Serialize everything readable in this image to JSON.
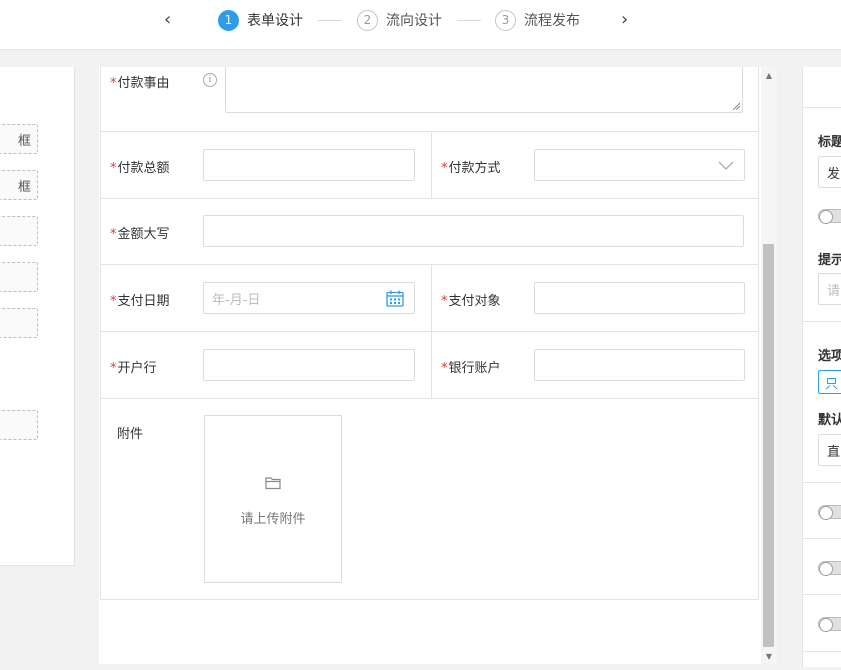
{
  "stepper": {
    "prev_icon": "chevron-left-icon",
    "next_icon": "chevron-right-icon",
    "steps": [
      {
        "number": "1",
        "label": "表单设计",
        "active": true
      },
      {
        "number": "2",
        "label": "流向设计",
        "active": false
      },
      {
        "number": "3",
        "label": "流程发布",
        "active": false
      }
    ]
  },
  "palette": {
    "items": [
      "框",
      "框",
      "",
      "",
      "",
      ""
    ]
  },
  "form": {
    "required_mark": "*",
    "reason_label": "付款事由",
    "total_label": "付款总额",
    "method_label": "付款方式",
    "uppercase_label": "金额大写",
    "date_label": "支付日期",
    "date_placeholder": "年-月-日",
    "payee_label": "支付对象",
    "bank_label": "开户行",
    "account_label": "银行账户",
    "attachment_label": "附件",
    "upload_text": "请上传附件"
  },
  "properties": {
    "title_label": "标题",
    "title_value": "发",
    "hint_label": "提示",
    "hint_placeholder": "请",
    "options_label": "选项",
    "option_value": "只",
    "default_label": "默认",
    "default_value": "直"
  },
  "colors": {
    "accent": "#2d9de9",
    "required": "#e53935"
  }
}
